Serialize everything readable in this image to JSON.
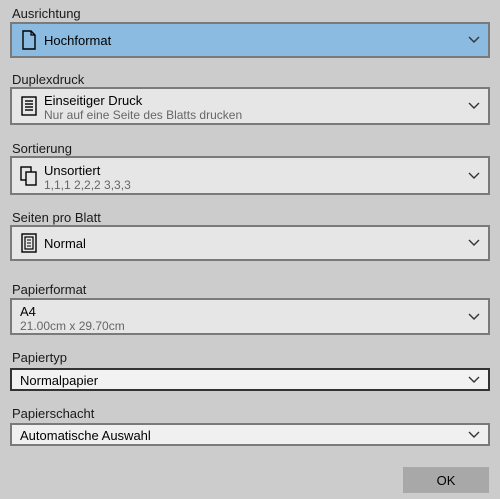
{
  "orientation": {
    "label": "Ausrichtung",
    "value": "Hochformat"
  },
  "duplex": {
    "label": "Duplexdruck",
    "value": "Einseitiger Druck",
    "detail": "Nur auf eine Seite des Blatts drucken"
  },
  "collation": {
    "label": "Sortierung",
    "value": "Unsortiert",
    "detail": "1,1,1  2,2,2  3,3,3"
  },
  "pages_per_sheet": {
    "label": "Seiten pro Blatt",
    "value": "Normal"
  },
  "paper_size": {
    "label": "Papierformat",
    "value": "A4",
    "detail": "21.00cm x 29.70cm"
  },
  "paper_type": {
    "label": "Papiertyp",
    "value": "Normalpapier"
  },
  "paper_tray": {
    "label": "Papierschacht",
    "value": "Automatische Auswahl"
  },
  "ok_button": {
    "label": "OK"
  }
}
